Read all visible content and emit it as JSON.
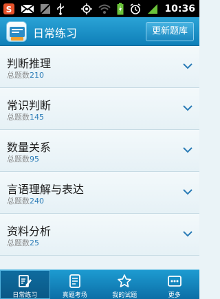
{
  "status_bar": {
    "time": "10:36",
    "icons": [
      "app-notification-icon",
      "mail-icon",
      "image-icon",
      "usb-icon",
      "gps-icon",
      "wifi-icon",
      "battery-charging-icon",
      "alarm-icon",
      "signal-icon"
    ]
  },
  "header": {
    "title": "日常练习",
    "update_button": "更新题库",
    "logo_icon": "app-logo-icon"
  },
  "list": {
    "items": [
      {
        "title": "判断推理",
        "count_label": "总题数",
        "count": "210"
      },
      {
        "title": "常识判断",
        "count_label": "总题数",
        "count": "145"
      },
      {
        "title": "数量关系",
        "count_label": "总题数",
        "count": "95"
      },
      {
        "title": "言语理解与表达",
        "count_label": "总题数",
        "count": "240"
      },
      {
        "title": "资料分析",
        "count_label": "总题数",
        "count": "25"
      }
    ]
  },
  "tabs": [
    {
      "label": "日常练习",
      "icon": "edit-note-icon",
      "active": true
    },
    {
      "label": "真题考场",
      "icon": "book-icon",
      "active": false
    },
    {
      "label": "我的试题",
      "icon": "star-icon",
      "active": false
    },
    {
      "label": "更多",
      "icon": "more-icon",
      "active": false
    }
  ],
  "colors": {
    "header_top": "#2aa3d6",
    "header_bottom": "#0f7fb8",
    "count_accent": "#2a7bb6",
    "list_background": "#eaf3f7"
  }
}
